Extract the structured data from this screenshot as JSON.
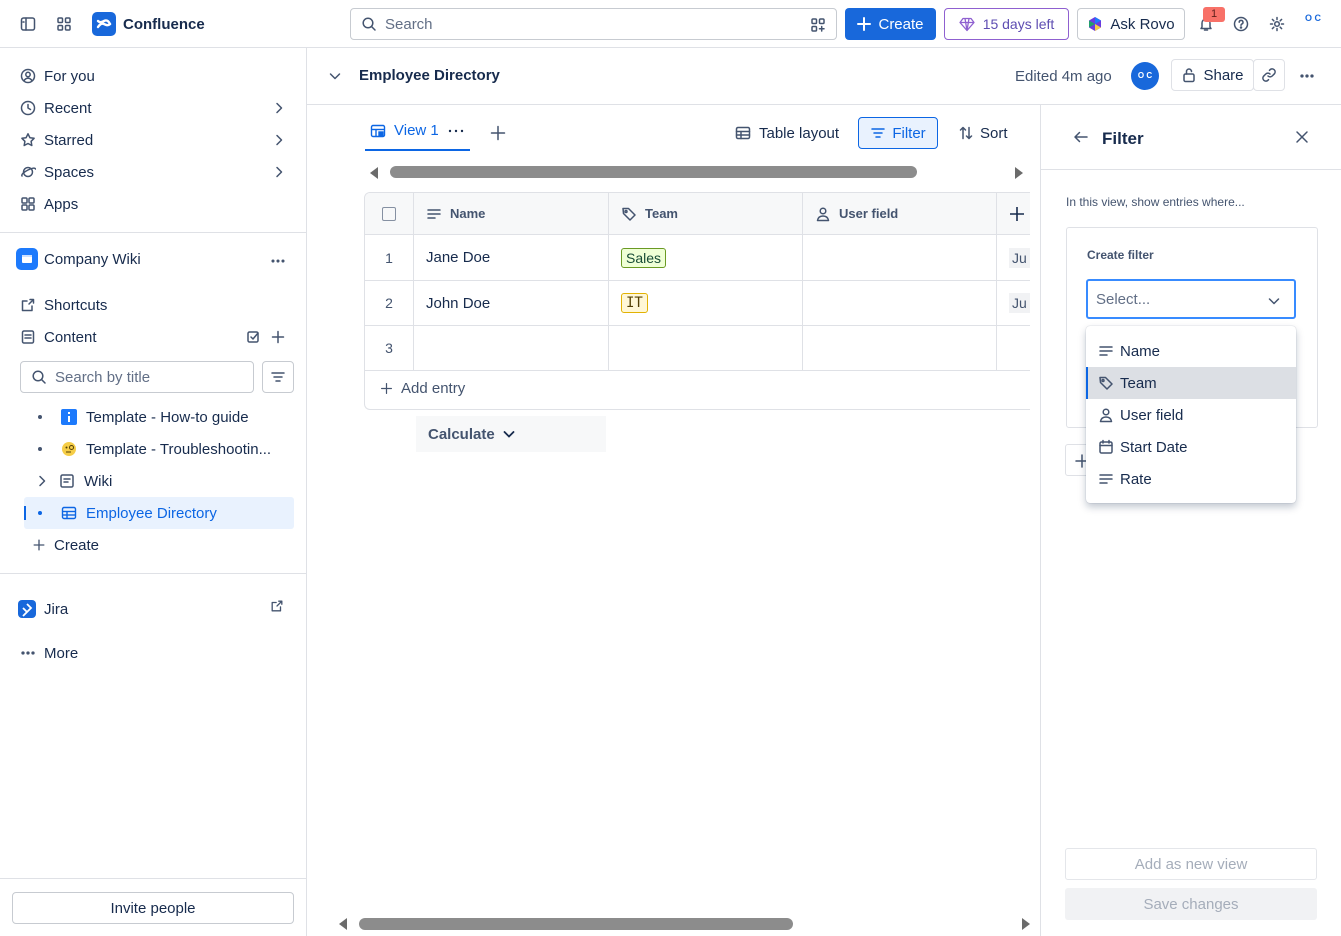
{
  "topbar": {
    "app_name": "Confluence",
    "search_placeholder": "Search",
    "create_label": "Create",
    "trial_label": "15 days left",
    "rovo_label": "Ask Rovo",
    "notification_count": "1",
    "avatar_initials": "O C"
  },
  "sidebar": {
    "nav": [
      {
        "label": "For you",
        "icon": "person-circle-icon"
      },
      {
        "label": "Recent",
        "icon": "clock-icon"
      },
      {
        "label": "Starred",
        "icon": "star-icon"
      },
      {
        "label": "Spaces",
        "icon": "planet-icon"
      },
      {
        "label": "Apps",
        "icon": "apps-icon"
      }
    ],
    "space_name": "Company Wiki",
    "shortcuts_label": "Shortcuts",
    "content_label": "Content",
    "search_placeholder": "Search by title",
    "tree": [
      {
        "label": "Template - How-to guide",
        "icon": "info-icon"
      },
      {
        "label": "Template - Troubleshootin...",
        "icon": "face-icon"
      },
      {
        "label": "Wiki",
        "icon": "page-icon"
      },
      {
        "label": "Employee Directory",
        "icon": "database-icon"
      }
    ],
    "create_label": "Create",
    "jira_label": "Jira",
    "more_label": "More",
    "invite_label": "Invite people"
  },
  "page": {
    "title": "Employee Directory",
    "edited": "Edited 4m ago",
    "avatar_initials": "O C",
    "share_label": "Share"
  },
  "database": {
    "view_tab": "View 1",
    "table_layout_label": "Table layout",
    "filter_label": "Filter",
    "sort_label": "Sort",
    "columns": [
      "Name",
      "Team",
      "User field"
    ],
    "rows": [
      {
        "num": "1",
        "name": "Jane Doe",
        "team": "Sales",
        "extra": "Ju"
      },
      {
        "num": "2",
        "name": "John Doe",
        "team": "IT",
        "extra": "Ju"
      },
      {
        "num": "3",
        "name": "",
        "team": "",
        "extra": ""
      }
    ],
    "add_entry_label": "Add entry",
    "calculate_label": "Calculate"
  },
  "filter_panel": {
    "title": "Filter",
    "subtitle": "In this view, show entries where...",
    "create_filter_label": "Create filter",
    "select_placeholder": "Select...",
    "options": [
      "Name",
      "Team",
      "User field",
      "Start Date",
      "Rate"
    ],
    "highlighted_option": "Team",
    "add_view_label": "Add as new view",
    "save_label": "Save changes"
  },
  "colors": {
    "brand_blue": "#1868db",
    "selected_bg": "#e9f2fe",
    "trial_purple": "#8f60d0"
  }
}
